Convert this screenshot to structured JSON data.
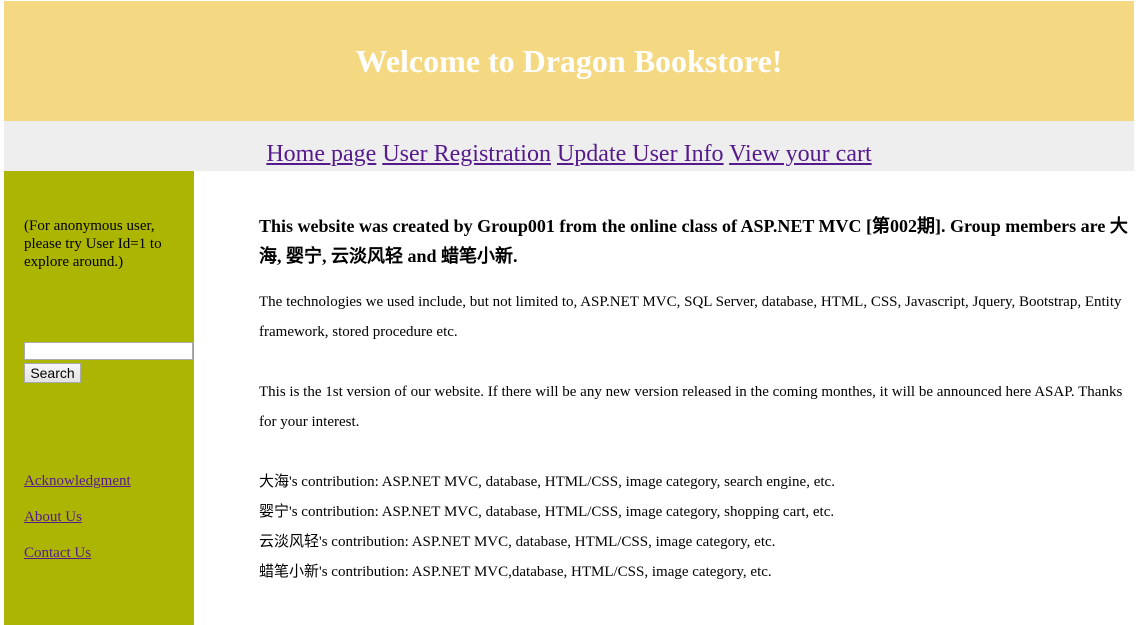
{
  "header": {
    "title": "Welcome to Dragon Bookstore!"
  },
  "nav": {
    "items": [
      "Home page",
      "User Registration",
      "Update User Info",
      "View your cart"
    ]
  },
  "sidebar": {
    "anon_note": "(For anonymous user, please try User Id=1 to explore around.)",
    "search_value": "",
    "search_button": "Search",
    "links": [
      "Acknowledgment",
      "About Us",
      "Contact Us"
    ]
  },
  "main": {
    "intro": "This website was created by Group001 from the online class of ASP.NET MVC [第002期]. Group members are 大海, 婴宁, 云淡风轻 and 蜡笔小新.",
    "tech": "The technologies we used include, but not limited to, ASP.NET MVC, SQL Server, database, HTML, CSS, Javascript, Jquery, Bootstrap, Entity framework, stored procedure etc.",
    "version": "This is the 1st version of our website. If there will be any new version released in the coming monthes, it will be announced here ASAP. Thanks for your interest.",
    "contributions": [
      "大海's contribution: ASP.NET MVC, database, HTML/CSS, image category, search engine, etc.",
      "婴宁's contribution: ASP.NET MVC, database, HTML/CSS, image category, shopping cart, etc.",
      "云淡风轻's contribution: ASP.NET MVC, database, HTML/CSS, image category, etc.",
      "蜡笔小新's contribution: ASP.NET MVC,database, HTML/CSS, image category, etc."
    ]
  }
}
